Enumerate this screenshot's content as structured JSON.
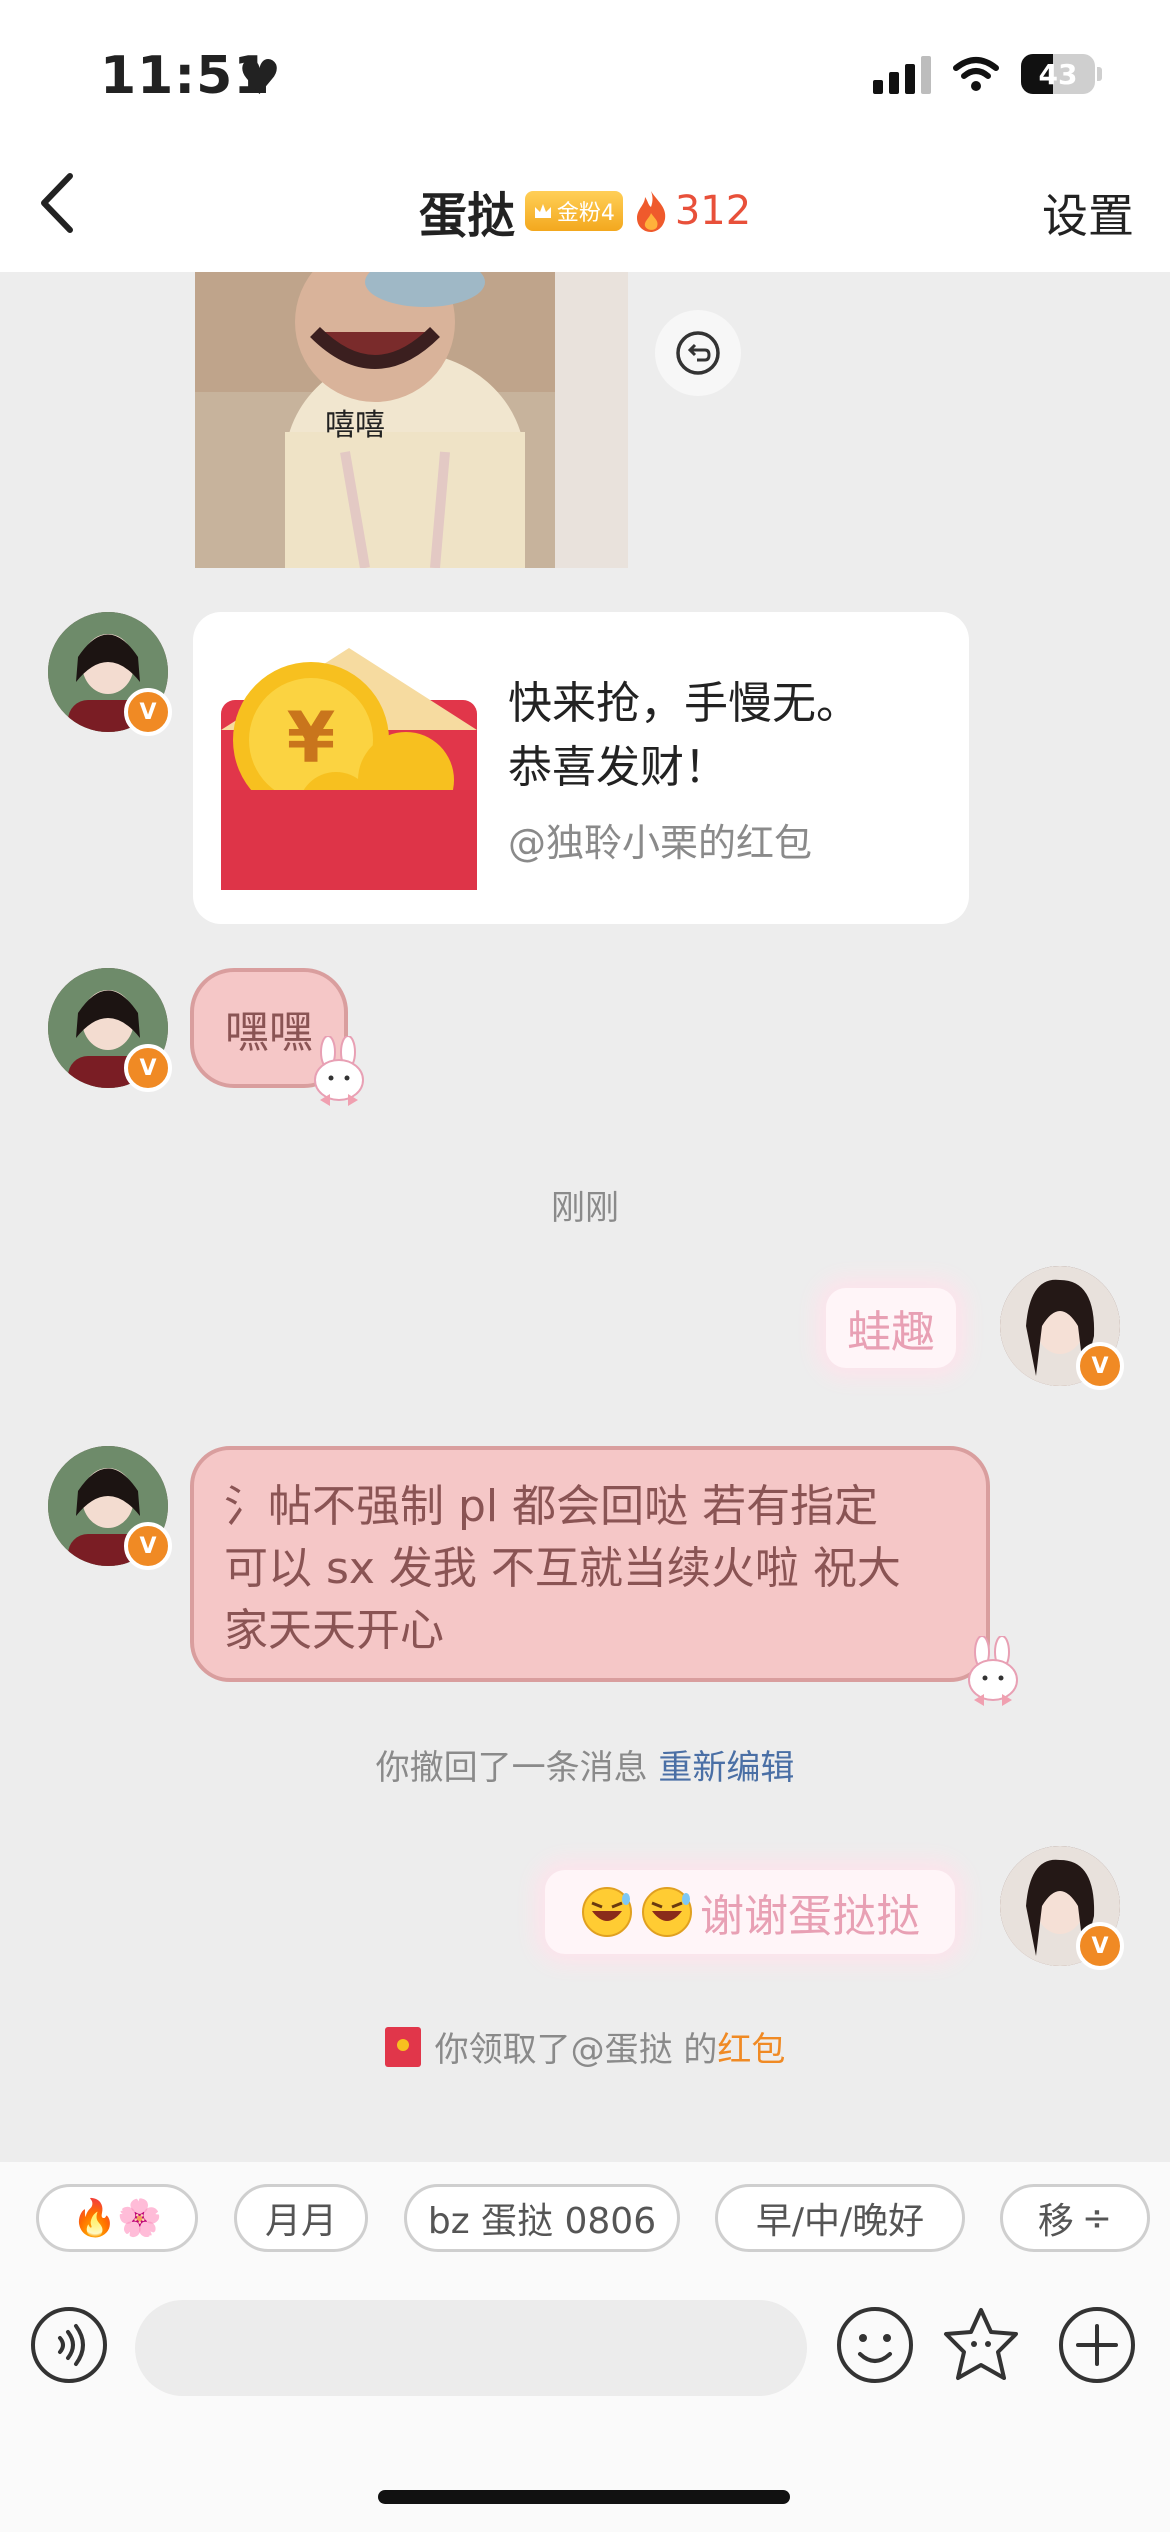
{
  "status": {
    "time": "11:51",
    "battery": "43"
  },
  "header": {
    "title": "蛋挞",
    "fan_badge": "金粉4",
    "fire_count": "312",
    "settings": "设置"
  },
  "messages": {
    "image_caption": "嘻嘻",
    "hongbao_line1": "快来抢，手慢无。",
    "hongbao_line2": "恭喜发财！",
    "hongbao_sub": "@独聆小栗的红包",
    "heihei": "嘿嘿",
    "timestamp": "刚刚",
    "wa_qu": "蛙趣",
    "long_msg_line1": "氵帖不强制 pl 都会回哒 若有指定",
    "long_msg_line2": "可以 sx 发我 不互就当续火啦 祝大",
    "long_msg_line3": "家天天开心",
    "recall_text": "你撤回了一条消息",
    "recall_link": "重新编辑",
    "thanks": "谢谢蛋挞挞",
    "received_prefix": "你领取了@蛋挞 的",
    "received_suffix": "红包"
  },
  "quick_replies": [
    "🔥🌸",
    "月月",
    "bz 蛋挞 0806",
    "早/中/晚好",
    "移"
  ],
  "icons": [
    "back-icon",
    "fire-icon",
    "voice-icon",
    "emoji-icon",
    "flower-icon",
    "plus-icon",
    "revoke-icon",
    "hongbao-icon"
  ]
}
